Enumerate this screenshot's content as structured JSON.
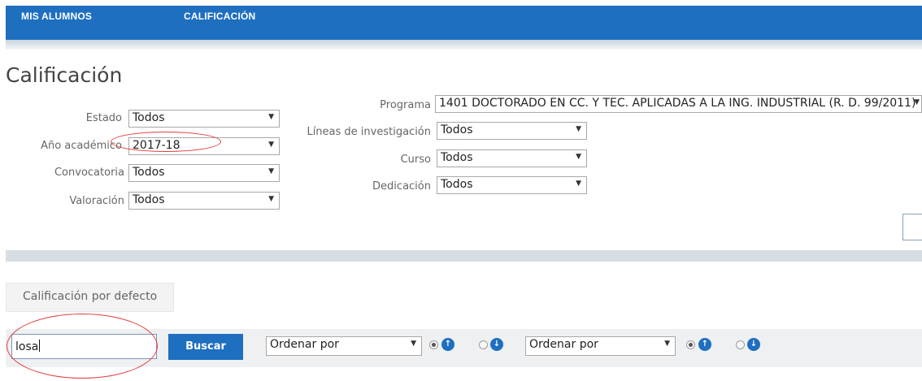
{
  "nav": {
    "items": [
      "MIS ALUMNOS",
      "CALIFICACIÓN"
    ]
  },
  "page": {
    "title": "Calificación"
  },
  "filters_left": [
    {
      "label": "Estado",
      "value": "Todos"
    },
    {
      "label": "Año académico",
      "value": "2017-18"
    },
    {
      "label": "Convocatoria",
      "value": "Todos"
    },
    {
      "label": "Valoración",
      "value": "Todos"
    }
  ],
  "filters_right": [
    {
      "label": "Programa",
      "value": "1401 DOCTORADO EN CC. Y TEC. APLICADAS A LA ING. INDUSTRIAL (R. D. 99/2011)"
    },
    {
      "label": "Líneas de investigación",
      "value": "Todos"
    },
    {
      "label": "Curso",
      "value": "Todos"
    },
    {
      "label": "Dedicación",
      "value": "Todos"
    }
  ],
  "tab": {
    "label": "Calificación por defecto"
  },
  "search": {
    "value": "losa",
    "button": "Buscar"
  },
  "sort": [
    {
      "value": "Ordenar por",
      "selected": "asc"
    },
    {
      "value": "Ordenar por",
      "selected": "asc"
    }
  ],
  "colors": {
    "accent": "#1e6fc0",
    "annotation": "#e03a3a"
  },
  "icons": [
    "chevron-down-icon",
    "sort-asc-icon",
    "sort-desc-icon"
  ]
}
